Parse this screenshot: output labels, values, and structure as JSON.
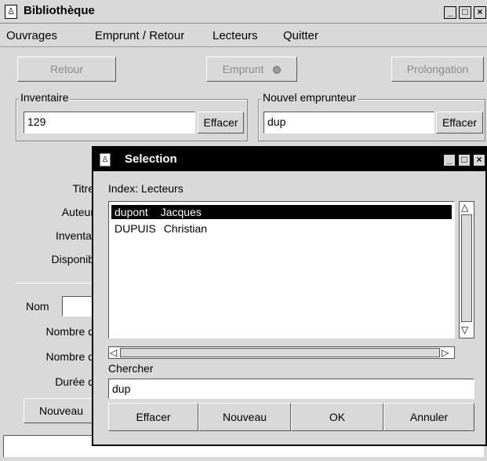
{
  "main_window": {
    "title": "Bibliothèque",
    "title_icon": "app-icon",
    "controls": {
      "minimize": "_",
      "maximize": "□",
      "close": "×"
    }
  },
  "menu": [
    "Ouvrages",
    "Emprunt / Retour",
    "Lecteurs",
    "Quitter"
  ],
  "toolbar": {
    "retour": "Retour",
    "emprunt": "Emprunt",
    "prolongation": "Prolongation"
  },
  "inventaire": {
    "label": "Inventaire",
    "value": "129",
    "clear": "Effacer"
  },
  "nouvel_emprunteur": {
    "label": "Nouvel emprunteur",
    "value": "dup",
    "clear": "Effacer"
  },
  "book_fields": [
    "Titre",
    "Auteur",
    "Inventai",
    "Disponib"
  ],
  "reader_fields": {
    "nom": "Nom",
    "nombre1": "Nombre d",
    "nombre2": "Nombre d",
    "duree": "Durée d",
    "nouveau": "Nouveau"
  },
  "dialog": {
    "title": "Selection",
    "index_label": "Index: Lecteurs",
    "items": [
      {
        "name": "dupont",
        "first": "Jacques",
        "selected": true
      },
      {
        "name": "DUPUIS",
        "first": "Christian",
        "selected": false
      }
    ],
    "search_label": "Chercher",
    "search_value": "dup",
    "buttons": {
      "effacer": "Effacer",
      "nouveau": "Nouveau",
      "ok": "OK",
      "annuler": "Annuler"
    }
  }
}
